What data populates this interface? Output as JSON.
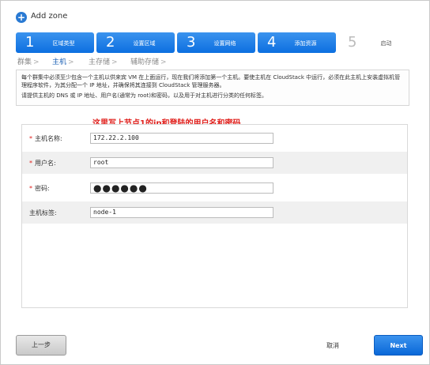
{
  "window": {
    "title": "Add zone",
    "icon": "plus-icon"
  },
  "steps": [
    {
      "num": "1",
      "label": "区域类型"
    },
    {
      "num": "2",
      "label": "设置区域"
    },
    {
      "num": "3",
      "label": "设置网络"
    },
    {
      "num": "4",
      "label": "添加资源"
    },
    {
      "num": "5",
      "label": "启动"
    }
  ],
  "substeps": [
    {
      "label": "群集"
    },
    {
      "label": "主机"
    },
    {
      "label": "主存储"
    },
    {
      "label": "辅助存储"
    }
  ],
  "info": {
    "line1": "每个群集中必须至少包含一个主机以供来宾 VM 在上面运行，现在我们将添加第一个主机。要使主机在 CloudStack 中运行，必须在此主机上安装虚拟机管理程序软件，为其分配一个 IP 地址，并确保将其连接到 CloudStack 管理服务器。",
    "line2": "请提供主机的 DNS 或 IP 地址、用户名(通常为 root)和密码，以及用于对主机进行分类的任何标签。"
  },
  "annotation": "这里写上节点1的ip和登陆的用户名和密码",
  "form": {
    "hostname": {
      "label": "主机名称:",
      "value": "172.22.2.100",
      "required": "*"
    },
    "username": {
      "label": "用户名:",
      "value": "root",
      "required": "*"
    },
    "password": {
      "label": "密码:",
      "value": "●●●●●●",
      "required": "*"
    },
    "hosttags": {
      "label": "主机标签:",
      "value": "node-1"
    }
  },
  "buttons": {
    "back": "上一步",
    "cancel": "取消",
    "next": "Next"
  },
  "colors": {
    "accent": "#0c6fe0",
    "required": "#e0201c",
    "annotation": "#e0201c"
  }
}
